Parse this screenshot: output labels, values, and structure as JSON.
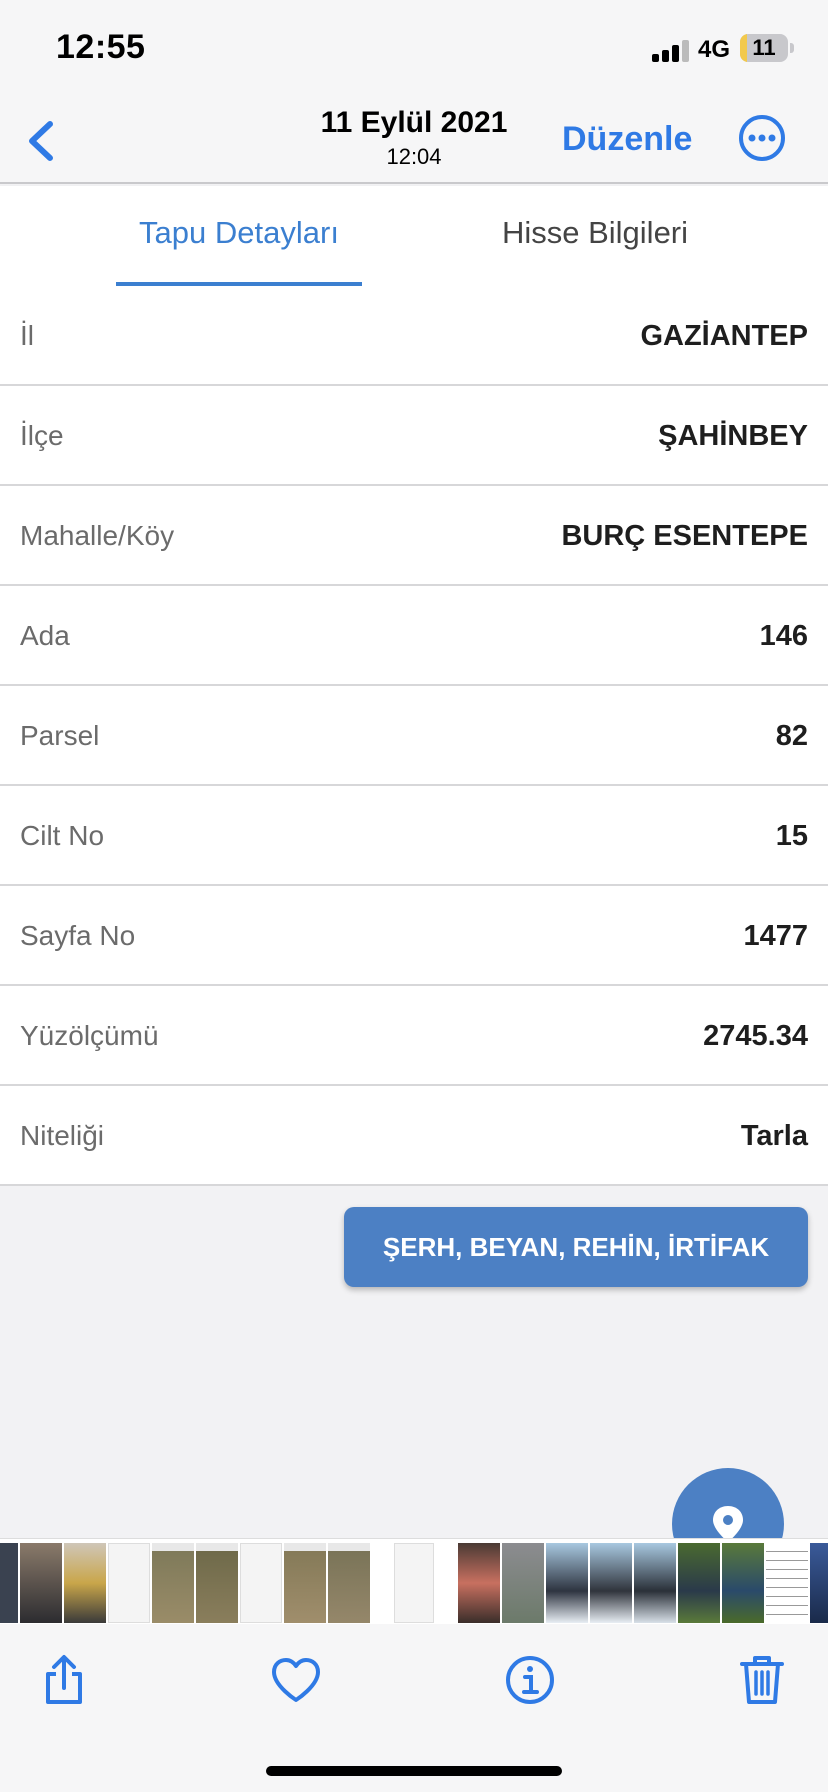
{
  "status_bar": {
    "time": "12:55",
    "network": "4G",
    "battery": "11",
    "battery_level": 0.11
  },
  "nav": {
    "title_date": "11 Eylül 2021",
    "title_time": "12:04",
    "edit_label": "Düzenle",
    "back_icon": "chevron-left-icon",
    "more_icon": "more-circle-icon"
  },
  "tabs": [
    {
      "label": "Tapu Detayları",
      "active": true
    },
    {
      "label": "Hisse Bilgileri",
      "active": false
    }
  ],
  "details": [
    {
      "label": "İl",
      "value": "GAZİANTEP"
    },
    {
      "label": "İlçe",
      "value": "ŞAHİNBEY"
    },
    {
      "label": "Mahalle/Köy",
      "value": "BURÇ ESENTEPE"
    },
    {
      "label": "Ada",
      "value": "146"
    },
    {
      "label": "Parsel",
      "value": "82"
    },
    {
      "label": "Cilt No",
      "value": "15"
    },
    {
      "label": "Sayfa No",
      "value": "1477"
    },
    {
      "label": "Yüzölçümü",
      "value": "2745.34"
    },
    {
      "label": "Niteliği",
      "value": "Tarla"
    }
  ],
  "action_button": {
    "label": "ŞERH, BEYAN, REHİN, İRTİFAK"
  },
  "fab_icon": "location-pin-icon",
  "toolbar": {
    "icons": [
      "share-icon",
      "heart-icon",
      "info-icon",
      "trash-icon"
    ]
  },
  "colors": {
    "accent": "#2f7ae5",
    "tab_active": "#3b7fd0",
    "button": "#4c80c4"
  }
}
